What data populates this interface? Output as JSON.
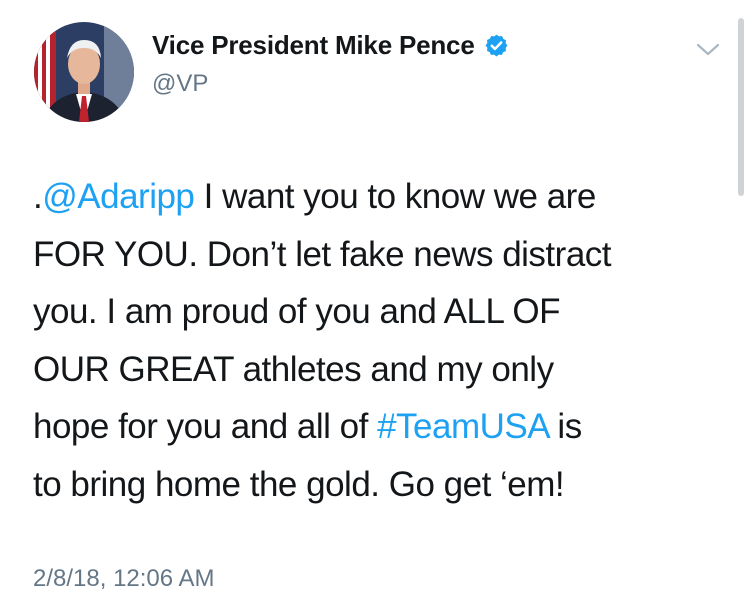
{
  "header": {
    "display_name": "Vice President Mike Pence",
    "handle": "@VP",
    "verified": true,
    "avatar_icon": "profile-photo-icon",
    "caret_icon": "chevron-down-icon"
  },
  "tweet": {
    "lines": [
      [
        {
          "text": ".",
          "type": "text"
        },
        {
          "text": "@Adaripp",
          "type": "mention"
        },
        {
          "text": " I want you to know we are",
          "type": "text"
        }
      ],
      [
        {
          "text": "FOR YOU. Don’t let fake news distract",
          "type": "text"
        }
      ],
      [
        {
          "text": "you. I am proud of you and ALL OF",
          "type": "text"
        }
      ],
      [
        {
          "text": "OUR GREAT athletes and my only",
          "type": "text"
        }
      ],
      [
        {
          "text": "hope for you and all of ",
          "type": "text"
        },
        {
          "text": "#TeamUSA",
          "type": "hashtag"
        },
        {
          "text": " is",
          "type": "text"
        }
      ],
      [
        {
          "text": "to bring home the gold. Go get ‘em!",
          "type": "text"
        }
      ]
    ],
    "timestamp": "2/8/18, 12:06 AM"
  },
  "colors": {
    "link": "#1da1f2",
    "secondary_text": "#657786",
    "primary_text": "#14171a",
    "verified_badge": "#1da1f2"
  }
}
